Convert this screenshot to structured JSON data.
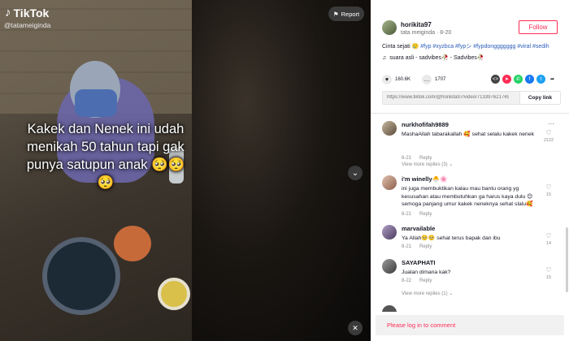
{
  "app": {
    "logo": "TikTok",
    "handle": "@tatameiginda"
  },
  "video": {
    "caption": "Kakek dan Nenek ini udah menikah 50 tahun tapi gak punya satupun anak 🥺🥺🥺",
    "report_label": "Report",
    "nav_down_icon": "chevron-down-icon",
    "mute_icon": "mute-icon"
  },
  "author": {
    "username": "horikita97",
    "subline": "tata meiginda · 8-20",
    "follow_label": "Follow"
  },
  "description": {
    "prefix": "Cinta sejati 🥲 ",
    "tags": "#fyp #xyzbca #fypシ #fypdonggggggg #viral #sedih"
  },
  "music": {
    "icon": "♫",
    "label": "suara asli - sadvibes🥀 - Sadvibes🥀"
  },
  "actions": {
    "likes": "160.6K",
    "comments": "1707"
  },
  "share_colors": {
    "embed": "#444444",
    "send": "#fe2c55",
    "whatsapp": "#25d366",
    "facebook": "#1877f2",
    "twitter": "#1da1f2",
    "more": "#161823"
  },
  "link": {
    "url": "https://www.tiktok.com/@horikita97/video/7133976217459...",
    "copy_label": "Copy link"
  },
  "comments": [
    {
      "name": "nurkhofifah9889",
      "text": "MashaAllah tabarakallah 🥰 sehat selalu kakek nenek",
      "date": "8-21",
      "reply": "Reply",
      "likes": "2122",
      "more": "View more replies (3) ⌄"
    },
    {
      "name": "i'm winelly🐣🌸",
      "text": "ini juga membuktikan kalau mau bantu orang yg kesusahan atau membutuhkan ga harus kaya dulu 😊 semoga panjang umur kakek neneknya sehat slalu🥰",
      "date": "8-21",
      "reply": "Reply",
      "likes": "15"
    },
    {
      "name": "marvailable",
      "text": "Ya Allah🥺🥺 sehat terus bapak dan ibu",
      "date": "8-21",
      "reply": "Reply",
      "likes": "14"
    },
    {
      "name": "SAYAPHATI",
      "text": "Jualan dimana kak?",
      "date": "8-22",
      "reply": "Reply",
      "likes": "15",
      "more": "View more replies (1) ⌄"
    }
  ],
  "login": {
    "label": "Please log in to comment"
  }
}
